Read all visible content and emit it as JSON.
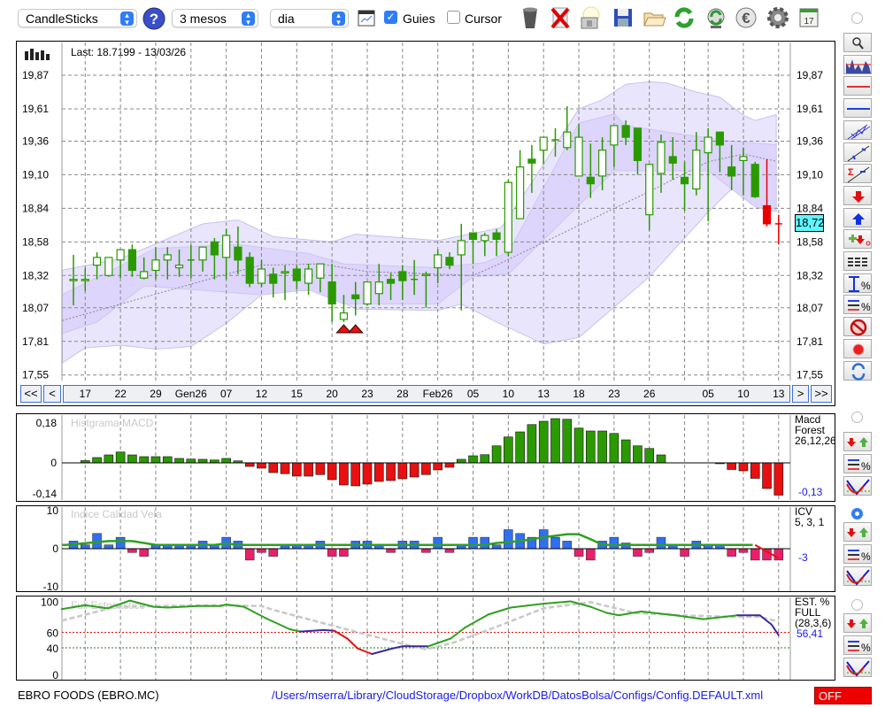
{
  "toolbar": {
    "chart_type": "CandleSticks",
    "period": "3 mesos",
    "interval": "dia",
    "guides_label": "Guies",
    "guides_checked": true,
    "cursor_label": "Cursor",
    "cursor_checked": false,
    "icons": [
      "help-icon",
      "chart-window-icon",
      "trash-icon",
      "delete-icon",
      "lamp-icon",
      "save-icon",
      "folder-icon",
      "refresh-icon",
      "sync-icon",
      "euro-icon",
      "gear-icon",
      "calendar-icon"
    ],
    "calendar_day": "17"
  },
  "main": {
    "last_label": "Last: 18.7199 - 13/03/26",
    "current_price": "18,72",
    "price_axis": [
      "19,87",
      "19,61",
      "19,36",
      "19,10",
      "18,84",
      "18,58",
      "18,32",
      "18,07",
      "17,81",
      "17,55"
    ],
    "candles": [
      [
        18.28,
        18.48,
        18.09,
        18.29
      ],
      [
        18.28,
        18.38,
        18.2,
        18.29
      ],
      [
        18.4,
        18.5,
        18.29,
        18.46
      ],
      [
        18.32,
        18.46,
        18.31,
        18.46
      ],
      [
        18.44,
        18.52,
        18.3,
        18.52
      ],
      [
        18.52,
        18.56,
        18.31,
        18.36
      ],
      [
        18.3,
        18.46,
        18.29,
        18.35
      ],
      [
        18.36,
        18.54,
        18.29,
        18.44
      ],
      [
        18.44,
        18.54,
        18.29,
        18.48
      ],
      [
        18.38,
        18.52,
        18.31,
        18.4
      ],
      [
        18.44,
        18.56,
        18.3,
        18.44
      ],
      [
        18.44,
        18.54,
        18.35,
        18.54
      ],
      [
        18.58,
        18.61,
        18.29,
        18.48
      ],
      [
        18.46,
        18.68,
        18.29,
        18.63
      ],
      [
        18.54,
        18.7,
        18.33,
        18.44
      ],
      [
        18.46,
        18.5,
        18.23,
        18.26
      ],
      [
        18.26,
        18.44,
        18.23,
        18.37
      ],
      [
        18.33,
        18.38,
        18.15,
        18.26
      ],
      [
        18.34,
        18.4,
        18.13,
        18.35
      ],
      [
        18.37,
        18.4,
        18.21,
        18.28
      ],
      [
        18.26,
        18.41,
        18.17,
        18.37
      ],
      [
        18.3,
        18.41,
        18.19,
        18.41
      ],
      [
        18.27,
        18.41,
        17.96,
        18.1
      ],
      [
        17.98,
        18.17,
        17.96,
        18.03
      ],
      [
        18.17,
        18.27,
        18.01,
        18.14
      ],
      [
        18.1,
        18.27,
        18.09,
        18.27
      ],
      [
        18.18,
        18.41,
        18.09,
        18.27
      ],
      [
        18.29,
        18.34,
        18.13,
        18.26
      ],
      [
        18.35,
        18.4,
        18.13,
        18.28
      ],
      [
        18.29,
        18.44,
        18.17,
        18.29
      ],
      [
        18.32,
        18.35,
        18.07,
        18.33
      ],
      [
        18.38,
        18.52,
        18.26,
        18.48
      ],
      [
        18.46,
        18.5,
        18.37,
        18.4
      ],
      [
        18.48,
        18.72,
        18.05,
        18.59
      ],
      [
        18.65,
        18.65,
        18.41,
        18.6
      ],
      [
        18.59,
        18.65,
        18.47,
        18.63
      ],
      [
        18.65,
        18.68,
        18.47,
        18.6
      ],
      [
        18.5,
        19.06,
        18.47,
        19.04
      ],
      [
        18.76,
        19.29,
        18.76,
        19.16
      ],
      [
        19.22,
        19.33,
        18.96,
        19.19
      ],
      [
        19.29,
        19.39,
        19.18,
        19.39
      ],
      [
        19.37,
        19.46,
        19.24,
        19.37
      ],
      [
        19.31,
        19.63,
        19.29,
        19.43
      ],
      [
        19.09,
        19.49,
        19.09,
        19.39
      ],
      [
        19.08,
        19.34,
        18.92,
        19.03
      ],
      [
        19.09,
        19.39,
        18.98,
        19.29
      ],
      [
        19.33,
        19.48,
        19.16,
        19.48
      ],
      [
        19.48,
        19.52,
        19.33,
        19.39
      ],
      [
        19.46,
        19.46,
        19.1,
        19.21
      ],
      [
        18.79,
        19.18,
        18.67,
        19.18
      ],
      [
        19.11,
        19.41,
        18.96,
        19.35
      ],
      [
        19.24,
        19.39,
        19.06,
        19.19
      ],
      [
        19.08,
        19.2,
        18.82,
        19.03
      ],
      [
        18.99,
        19.43,
        18.94,
        19.29
      ],
      [
        19.27,
        19.46,
        18.74,
        19.39
      ],
      [
        19.43,
        19.43,
        19.12,
        19.33
      ],
      [
        19.16,
        19.33,
        18.98,
        19.09
      ],
      [
        19.21,
        19.31,
        18.94,
        19.24
      ],
      [
        19.18,
        19.2,
        18.92,
        18.93
      ],
      [
        18.86,
        19.22,
        18.7,
        18.72
      ],
      [
        18.72,
        18.79,
        18.56,
        18.72
      ]
    ],
    "red_from_index": 59,
    "bands": {
      "outer_upper": [
        [
          -1,
          18.36
        ],
        [
          4,
          18.45
        ],
        [
          11,
          18.72
        ],
        [
          14,
          18.75
        ],
        [
          17,
          18.62
        ],
        [
          22,
          18.58
        ],
        [
          24,
          18.64
        ],
        [
          31,
          18.59
        ],
        [
          36.4,
          18.69
        ],
        [
          39,
          19.04
        ],
        [
          43,
          19.61
        ],
        [
          45,
          19.68
        ],
        [
          47,
          19.8
        ],
        [
          49,
          19.82
        ],
        [
          50.5,
          19.81
        ],
        [
          53,
          19.74
        ],
        [
          55,
          19.7
        ],
        [
          57,
          19.56
        ],
        [
          58,
          19.52
        ],
        [
          60,
          19.57
        ]
      ],
      "outer_lower": [
        [
          -1,
          17.64
        ],
        [
          1,
          17.76
        ],
        [
          4,
          17.78
        ],
        [
          7,
          17.75
        ],
        [
          10,
          17.77
        ],
        [
          13,
          17.95
        ],
        [
          16,
          18.17
        ],
        [
          19,
          18.2
        ],
        [
          21,
          18.21
        ],
        [
          24,
          18.06
        ],
        [
          31,
          18.05
        ],
        [
          33,
          18.1
        ],
        [
          36,
          17.96
        ],
        [
          40,
          17.79
        ],
        [
          43,
          17.84
        ],
        [
          49,
          18.31
        ],
        [
          54,
          18.81
        ],
        [
          56,
          18.99
        ],
        [
          60,
          18.81
        ]
      ],
      "inner_upper": [
        [
          -1,
          18.17
        ],
        [
          7,
          18.53
        ],
        [
          14,
          18.56
        ],
        [
          20,
          18.49
        ],
        [
          23,
          18.41
        ],
        [
          31,
          18.38
        ],
        [
          35,
          18.42
        ],
        [
          37,
          18.5
        ],
        [
          43,
          19.5
        ],
        [
          46,
          19.57
        ],
        [
          47,
          19.48
        ],
        [
          52,
          19.41
        ],
        [
          56,
          19.36
        ],
        [
          60,
          19.33
        ]
      ],
      "inner_lower": [
        [
          -1,
          17.87
        ],
        [
          2,
          17.96
        ],
        [
          6,
          18.24
        ],
        [
          16,
          18.17
        ],
        [
          20,
          18.21
        ],
        [
          23,
          18.1
        ],
        [
          31,
          18.1
        ],
        [
          34,
          18.31
        ],
        [
          37,
          18.33
        ],
        [
          46,
          19.13
        ],
        [
          54,
          19.13
        ],
        [
          56,
          18.99
        ],
        [
          58,
          18.85
        ],
        [
          60,
          18.81
        ]
      ],
      "middle": [
        [
          -1,
          17.97
        ],
        [
          13,
          18.33
        ],
        [
          16,
          18.4
        ],
        [
          21,
          18.41
        ],
        [
          25,
          18.35
        ],
        [
          34,
          18.32
        ],
        [
          36,
          18.4
        ],
        [
          41,
          18.62
        ],
        [
          49,
          18.97
        ],
        [
          54,
          19.2
        ],
        [
          57,
          19.26
        ],
        [
          60,
          19.2
        ]
      ]
    },
    "signal_indices": [
      23,
      24
    ],
    "date_labels": [
      {
        "i": 1,
        "t": "17"
      },
      {
        "i": 4,
        "t": "22"
      },
      {
        "i": 7,
        "t": "29"
      },
      {
        "i": 10,
        "t": "Gen26"
      },
      {
        "i": 13,
        "t": "07"
      },
      {
        "i": 16,
        "t": "12"
      },
      {
        "i": 19,
        "t": "15"
      },
      {
        "i": 22,
        "t": "20"
      },
      {
        "i": 25,
        "t": "23"
      },
      {
        "i": 28,
        "t": "28"
      },
      {
        "i": 31,
        "t": "Feb26"
      },
      {
        "i": 34,
        "t": "05"
      },
      {
        "i": 37,
        "t": "10"
      },
      {
        "i": 40,
        "t": "13"
      },
      {
        "i": 43,
        "t": "18"
      },
      {
        "i": 46,
        "t": "23"
      },
      {
        "i": 49,
        "t": "26"
      },
      {
        "i": 54,
        "t": "05"
      },
      {
        "i": 57,
        "t": "10"
      },
      {
        "i": 60,
        "t": "13"
      }
    ],
    "nav": {
      "first": "<<",
      "prev": "<",
      "next": ">",
      "last": ">>"
    }
  },
  "macd": {
    "title": "Histgrama MACD",
    "axis": [
      "0,18",
      "0",
      "-0,14"
    ],
    "legend": [
      "Macd",
      "Forest",
      "26,12,26"
    ],
    "value": "-0,13",
    "values": [
      null,
      0.01,
      0.024,
      0.036,
      0.049,
      0.036,
      0.028,
      0.028,
      0.028,
      0.02,
      0.017,
      0.016,
      0.013,
      0.02,
      0.009,
      -0.016,
      -0.024,
      -0.044,
      -0.049,
      -0.06,
      -0.06,
      -0.053,
      -0.076,
      -0.1,
      -0.104,
      -0.096,
      -0.084,
      -0.08,
      -0.072,
      -0.064,
      -0.053,
      -0.032,
      -0.02,
      0.016,
      0.032,
      0.037,
      0.077,
      0.117,
      0.14,
      0.173,
      0.188,
      0.2,
      0.197,
      0.157,
      0.144,
      0.144,
      0.133,
      0.104,
      0.077,
      0.065,
      0.036,
      null,
      null,
      null,
      null,
      -0.004,
      -0.03,
      -0.036,
      -0.07,
      -0.116,
      -0.146
    ]
  },
  "icv": {
    "title": "Indice Calidad Vela",
    "axis": [
      "10",
      "0",
      "-10"
    ],
    "legend": [
      "ICV",
      "5, 3, 1"
    ],
    "value": "-3",
    "values": [
      2,
      1,
      4,
      1,
      3,
      -1,
      -2,
      1,
      1,
      1,
      1,
      2,
      1,
      3,
      2,
      -3,
      -1,
      -2,
      1,
      1,
      1,
      2,
      -2,
      -2,
      2,
      2,
      1,
      -1,
      2,
      2,
      -1,
      3,
      -1,
      1,
      3,
      3,
      1,
      5,
      4,
      3,
      5,
      3,
      2,
      -2,
      -3,
      2,
      3,
      1.5,
      -2,
      -1,
      3,
      1,
      -2,
      2,
      1,
      1,
      -2,
      -1,
      -3,
      -3,
      -3
    ],
    "signal": [
      [
        -0.6,
        1
      ],
      [
        3,
        2
      ],
      [
        5,
        2
      ],
      [
        7,
        1
      ],
      [
        12,
        1
      ],
      [
        13,
        1.4
      ],
      [
        14,
        1
      ],
      [
        35,
        1
      ],
      [
        36,
        1.5
      ],
      [
        38,
        2
      ],
      [
        40,
        3
      ],
      [
        42,
        3.8
      ],
      [
        43,
        3.8
      ],
      [
        44,
        2.5
      ],
      [
        45,
        1
      ],
      [
        58,
        1
      ],
      [
        60,
        -2.5
      ]
    ]
  },
  "stoch": {
    "title": "Full Estocastico",
    "axis": [
      "100",
      "60",
      "40",
      "0"
    ],
    "legend": [
      "EST. %",
      "FULL",
      "(28,3,6)"
    ],
    "value": "56,41",
    "k": [
      [
        -1,
        90,
        "g"
      ],
      [
        1,
        95,
        "g"
      ],
      [
        2.9,
        91,
        "g"
      ],
      [
        4.8,
        101,
        "g"
      ],
      [
        6.8,
        93,
        "g"
      ],
      [
        8,
        92,
        "g"
      ],
      [
        10.6,
        94,
        "g"
      ],
      [
        12.5,
        94,
        "g"
      ],
      [
        13,
        96,
        "g"
      ],
      [
        14.5,
        93,
        "g"
      ],
      [
        16.4,
        78,
        "g"
      ],
      [
        18.4,
        64,
        "g"
      ],
      [
        19.3,
        61,
        "g"
      ],
      [
        21.3,
        63,
        "b"
      ],
      [
        22.2,
        62,
        "b"
      ],
      [
        23.3,
        52,
        "r"
      ],
      [
        24.2,
        39,
        "r"
      ],
      [
        25.4,
        32,
        "r"
      ],
      [
        27.1,
        39,
        "b"
      ],
      [
        28,
        42,
        "b"
      ],
      [
        30.2,
        42,
        "b"
      ],
      [
        32.1,
        52,
        "g"
      ],
      [
        33.3,
        66,
        "g"
      ],
      [
        35.3,
        83,
        "g"
      ],
      [
        37.2,
        92,
        "g"
      ],
      [
        40,
        97,
        "g"
      ],
      [
        42.3,
        100,
        "g"
      ],
      [
        44,
        93,
        "g"
      ],
      [
        45.4,
        85,
        "g"
      ],
      [
        46.4,
        82,
        "g"
      ],
      [
        48.3,
        87,
        "g"
      ],
      [
        51.2,
        82,
        "g"
      ],
      [
        53.6,
        77,
        "g"
      ],
      [
        56.5,
        82,
        "g"
      ],
      [
        58.4,
        82,
        "b"
      ],
      [
        59.4,
        70,
        "b"
      ],
      [
        60,
        56.4,
        "b"
      ]
    ],
    "d": [
      [
        -1,
        75
      ],
      [
        3.6,
        93
      ],
      [
        11.7,
        95
      ],
      [
        16,
        94
      ],
      [
        17,
        89
      ],
      [
        22.7,
        66
      ],
      [
        27.5,
        47
      ],
      [
        30,
        38
      ],
      [
        32.4,
        47
      ],
      [
        35.8,
        66
      ],
      [
        40,
        91
      ],
      [
        44,
        99
      ],
      [
        47.8,
        85
      ],
      [
        51.7,
        82
      ],
      [
        56,
        80
      ],
      [
        58.4,
        80
      ],
      [
        60,
        74
      ]
    ],
    "levels": [
      60,
      40
    ]
  },
  "sidebar": {
    "main_tools": [
      "zoom-tool",
      "indicator-overlay",
      "horizontal-red-line",
      "horizontal-blue-line",
      "channel-tool",
      "trendline-tool",
      "sum-trendline-tool",
      "sell-signal",
      "buy-signal",
      "add-remove-signal",
      "levels-tool",
      "percent-range-tool",
      "percent-lines-tool",
      "clear-tool",
      "record-tool",
      "refresh-tool"
    ],
    "indicator_tools": [
      "signals",
      "percent-lines",
      "curve"
    ]
  },
  "footer": {
    "symbol": "EBRO FOODS (EBRO.MC)",
    "config_path": "/Users/mserra/Library/CloudStorage/Dropbox/WorkDB/DatosBolsa/Configs/Config.DEFAULT.xml",
    "status": "OFF"
  },
  "colors": {
    "candle_green": "#2a9a00",
    "candle_red": "#e80000",
    "macd_negative": "#e81010",
    "icv_positive": "#2f6ff0",
    "icv_negative": "#e8206a",
    "band_outer": "#e9e5fd",
    "band_inner": "#ddd5fb",
    "current_price_bg": "#5ff7ff",
    "status_bg": "#ee0000",
    "link_blue": "#1a1aee"
  }
}
